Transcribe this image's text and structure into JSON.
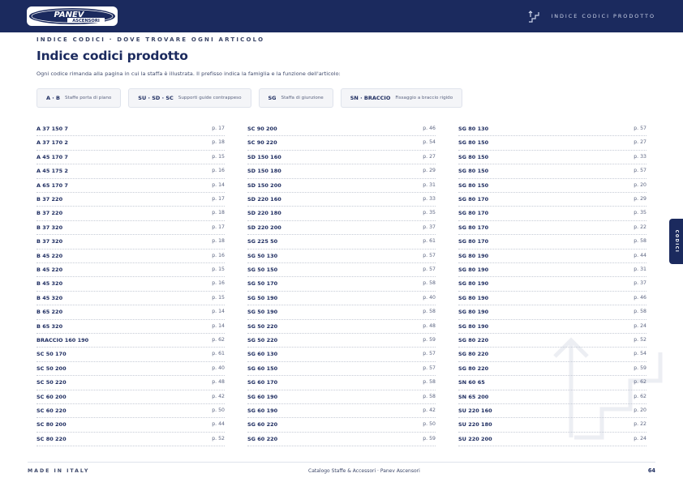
{
  "header": {
    "logo_top": "PANEV",
    "logo_bottom": "ASCENSORI",
    "right_label": "INDICE CODICI PRODOTTO"
  },
  "eyebrow": "INDICE CODICI · DOVE TROVARE OGNI ARTICOLO",
  "title": "Indice codici prodotto",
  "subtitle": "Ogni codice rimanda alla pagina in cui la staffa è illustrata. Il prefisso indica la famiglia e la funzione dell'articolo:",
  "legend": [
    {
      "code": "A · B",
      "desc": "Staffe porta di piano"
    },
    {
      "code": "SU · SD · SC",
      "desc": "Supporti guide contrappeso"
    },
    {
      "code": "SG",
      "desc": "Staffa di giunzione"
    },
    {
      "code": "SN · BRACCIO",
      "desc": "Fissaggio a braccio rigido"
    }
  ],
  "columns": [
    [
      {
        "code": "A 37 150 7",
        "page": "p. 17"
      },
      {
        "code": "A 37 170 2",
        "page": "p. 18"
      },
      {
        "code": "A 45 170 7",
        "page": "p. 15"
      },
      {
        "code": "A 45 175 2",
        "page": "p. 16"
      },
      {
        "code": "A 65 170 7",
        "page": "p. 14"
      },
      {
        "code": "B 37 220",
        "page": "p. 17"
      },
      {
        "code": "B 37 220",
        "page": "p. 18"
      },
      {
        "code": "B 37 320",
        "page": "p. 17"
      },
      {
        "code": "B 37 320",
        "page": "p. 18"
      },
      {
        "code": "B 45 220",
        "page": "p. 16"
      },
      {
        "code": "B 45 220",
        "page": "p. 15"
      },
      {
        "code": "B 45 320",
        "page": "p. 16"
      },
      {
        "code": "B 45 320",
        "page": "p. 15"
      },
      {
        "code": "B 65 220",
        "page": "p. 14"
      },
      {
        "code": "B 65 320",
        "page": "p. 14"
      },
      {
        "code": "BRACCIO 160 190",
        "page": "p. 62"
      },
      {
        "code": "SC 50 170",
        "page": "p. 61"
      },
      {
        "code": "SC 50 200",
        "page": "p. 40"
      },
      {
        "code": "SC 50 220",
        "page": "p. 48"
      },
      {
        "code": "SC 60 200",
        "page": "p. 42"
      },
      {
        "code": "SC 60 220",
        "page": "p. 50"
      },
      {
        "code": "SC 80 200",
        "page": "p. 44"
      },
      {
        "code": "SC 80 220",
        "page": "p. 52"
      }
    ],
    [
      {
        "code": "SC 90 200",
        "page": "p. 46"
      },
      {
        "code": "SC 90 220",
        "page": "p. 54"
      },
      {
        "code": "SD 150 160",
        "page": "p. 27"
      },
      {
        "code": "SD 150 180",
        "page": "p. 29"
      },
      {
        "code": "SD 150 200",
        "page": "p. 31"
      },
      {
        "code": "SD 220 160",
        "page": "p. 33"
      },
      {
        "code": "SD 220 180",
        "page": "p. 35"
      },
      {
        "code": "SD 220 200",
        "page": "p. 37"
      },
      {
        "code": "SG 225 50",
        "page": "p. 61"
      },
      {
        "code": "SG 50 130",
        "page": "p. 57"
      },
      {
        "code": "SG 50 150",
        "page": "p. 57"
      },
      {
        "code": "SG 50 170",
        "page": "p. 58"
      },
      {
        "code": "SG 50 190",
        "page": "p. 40"
      },
      {
        "code": "SG 50 190",
        "page": "p. 58"
      },
      {
        "code": "SG 50 220",
        "page": "p. 48"
      },
      {
        "code": "SG 50 220",
        "page": "p. 59"
      },
      {
        "code": "SG 60 130",
        "page": "p. 57"
      },
      {
        "code": "SG 60 150",
        "page": "p. 57"
      },
      {
        "code": "SG 60 170",
        "page": "p. 58"
      },
      {
        "code": "SG 60 190",
        "page": "p. 58"
      },
      {
        "code": "SG 60 190",
        "page": "p. 42"
      },
      {
        "code": "SG 60 220",
        "page": "p. 50"
      },
      {
        "code": "SG 60 220",
        "page": "p. 59"
      }
    ],
    [
      {
        "code": "SG 80 130",
        "page": "p. 57"
      },
      {
        "code": "SG 80 150",
        "page": "p. 27"
      },
      {
        "code": "SG 80 150",
        "page": "p. 33"
      },
      {
        "code": "SG 80 150",
        "page": "p. 57"
      },
      {
        "code": "SG 80 150",
        "page": "p. 20"
      },
      {
        "code": "SG 80 170",
        "page": "p. 29"
      },
      {
        "code": "SG 80 170",
        "page": "p. 35"
      },
      {
        "code": "SG 80 170",
        "page": "p. 22"
      },
      {
        "code": "SG 80 170",
        "page": "p. 58"
      },
      {
        "code": "SG 80 190",
        "page": "p. 44"
      },
      {
        "code": "SG 80 190",
        "page": "p. 31"
      },
      {
        "code": "SG 80 190",
        "page": "p. 37"
      },
      {
        "code": "SG 80 190",
        "page": "p. 46"
      },
      {
        "code": "SG 80 190",
        "page": "p. 58"
      },
      {
        "code": "SG 80 190",
        "page": "p. 24"
      },
      {
        "code": "SG 80 220",
        "page": "p. 52"
      },
      {
        "code": "SG 80 220",
        "page": "p. 54"
      },
      {
        "code": "SG 80 220",
        "page": "p. 59"
      },
      {
        "code": "SN 60 65",
        "page": "p. 62"
      },
      {
        "code": "SN 65 200",
        "page": "p. 62"
      },
      {
        "code": "SU 220 160",
        "page": "p. 20"
      },
      {
        "code": "SU 220 180",
        "page": "p. 22"
      },
      {
        "code": "SU 220 200",
        "page": "p. 24"
      }
    ]
  ],
  "side_tab": "CODICI",
  "footer": {
    "left": "MADE IN ITALY",
    "center": "Catalogo Staffe & Accessori · Panev Ascensori",
    "page_number": "64"
  }
}
